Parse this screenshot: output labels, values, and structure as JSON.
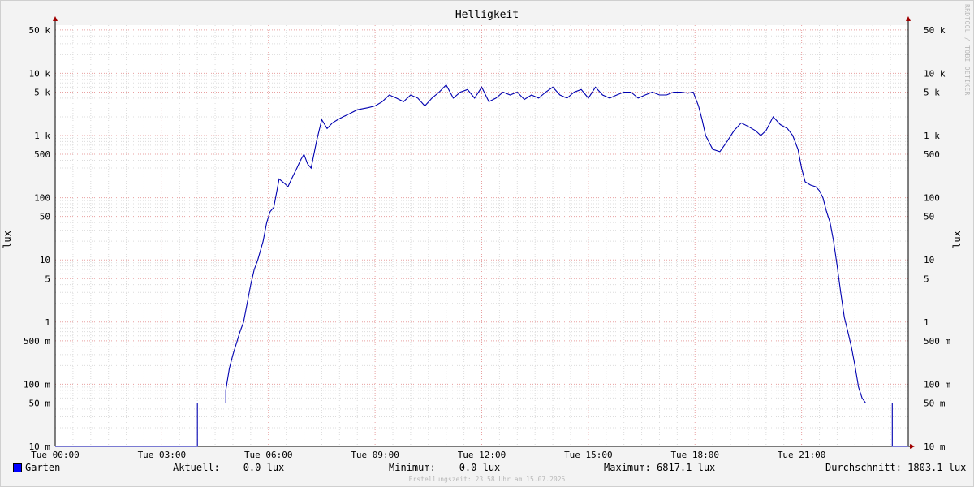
{
  "title": "Helligkeit",
  "watermark": "RRDTOOL / TOBI OETIKER",
  "legend": {
    "series_name": "Garten",
    "current": "Aktuell:    0.0 lux",
    "minimum": "Minimum:    0.0 lux",
    "maximum": "Maximum: 6817.1 lux",
    "average": "Durchschnitt: 1803.1 lux"
  },
  "footer": "Erstellungszeit: 23:58 Uhr am 15.07.2025",
  "colors": {
    "series": "#0000b0",
    "grid_major": "#e8a0a0",
    "grid_minor": "#dcdcdc",
    "background": "#ffffff",
    "axis_arrow": "#a00000",
    "legend_swatch": "#0000ff"
  },
  "chart_data": {
    "type": "line",
    "title": "Helligkeit",
    "ylabel": "lux",
    "yscale": "log",
    "ylim": [
      0.01,
      100000
    ],
    "xlim_hours": [
      0,
      24
    ],
    "grid": true,
    "x_ticks": [
      {
        "hour": 0,
        "label": "Tue 00:00"
      },
      {
        "hour": 3,
        "label": "Tue 03:00"
      },
      {
        "hour": 6,
        "label": "Tue 06:00"
      },
      {
        "hour": 9,
        "label": "Tue 09:00"
      },
      {
        "hour": 12,
        "label": "Tue 12:00"
      },
      {
        "hour": 15,
        "label": "Tue 15:00"
      },
      {
        "hour": 18,
        "label": "Tue 18:00"
      },
      {
        "hour": 21,
        "label": "Tue 21:00"
      }
    ],
    "y_ticks": [
      {
        "value": 0.01,
        "label": "10 m"
      },
      {
        "value": 0.05,
        "label": "50 m"
      },
      {
        "value": 0.1,
        "label": "100 m"
      },
      {
        "value": 0.5,
        "label": "500 m"
      },
      {
        "value": 1,
        "label": "1"
      },
      {
        "value": 5,
        "label": "5"
      },
      {
        "value": 10,
        "label": "10"
      },
      {
        "value": 50,
        "label": "50"
      },
      {
        "value": 100,
        "label": "100"
      },
      {
        "value": 500,
        "label": "500"
      },
      {
        "value": 1000,
        "label": "1 k"
      },
      {
        "value": 5000,
        "label": "5 k"
      },
      {
        "value": 10000,
        "label": "10 k"
      },
      {
        "value": 50000,
        "label": "50 k"
      }
    ],
    "series": [
      {
        "name": "Garten",
        "x_hours": [
          0,
          4.0,
          4.0,
          4.8,
          4.8,
          4.9,
          5.0,
          5.2,
          5.3,
          5.4,
          5.5,
          5.6,
          5.7,
          5.85,
          5.95,
          6.05,
          6.15,
          6.3,
          6.45,
          6.55,
          6.65,
          6.8,
          6.9,
          7.0,
          7.1,
          7.2,
          7.35,
          7.5,
          7.65,
          7.8,
          7.95,
          8.1,
          8.25,
          8.5,
          8.8,
          9.0,
          9.2,
          9.4,
          9.6,
          9.8,
          10.0,
          10.2,
          10.4,
          10.6,
          10.8,
          11.0,
          11.2,
          11.4,
          11.6,
          11.8,
          12.0,
          12.2,
          12.4,
          12.6,
          12.8,
          13.0,
          13.2,
          13.4,
          13.6,
          13.8,
          14.0,
          14.2,
          14.4,
          14.6,
          14.8,
          15.0,
          15.2,
          15.4,
          15.6,
          15.8,
          16.0,
          16.2,
          16.4,
          16.6,
          16.8,
          17.0,
          17.2,
          17.4,
          17.6,
          17.8,
          17.95,
          18.1,
          18.2,
          18.3,
          18.5,
          18.7,
          18.9,
          19.1,
          19.3,
          19.5,
          19.7,
          19.85,
          20.0,
          20.2,
          20.4,
          20.6,
          20.75,
          20.9,
          21.0,
          21.1,
          21.25,
          21.4,
          21.5,
          21.6,
          21.7,
          21.8,
          21.9,
          22.0,
          22.1,
          22.2,
          22.3,
          22.4,
          22.5,
          22.6,
          22.7,
          22.8,
          22.9,
          23.0,
          23.0,
          23.55,
          23.55,
          24.0
        ],
        "values": [
          0.01,
          0.01,
          0.05,
          0.05,
          0.08,
          0.18,
          0.3,
          0.7,
          1.0,
          2.0,
          4.0,
          7.0,
          10.0,
          20.0,
          40.0,
          60.0,
          70.0,
          200.0,
          170.0,
          150.0,
          200.0,
          300.0,
          400.0,
          500.0,
          350.0,
          300.0,
          800.0,
          1800.0,
          1300.0,
          1600.0,
          1800.0,
          2000.0,
          2200.0,
          2600.0,
          2800.0,
          3000.0,
          3500.0,
          4500.0,
          4000.0,
          3500.0,
          4500.0,
          4000.0,
          3000.0,
          4000.0,
          5000.0,
          6500.0,
          4000.0,
          5000.0,
          5500.0,
          4000.0,
          6000.0,
          3500.0,
          4000.0,
          5000.0,
          4500.0,
          5000.0,
          3800.0,
          4500.0,
          4000.0,
          5000.0,
          6000.0,
          4500.0,
          4000.0,
          5000.0,
          5500.0,
          4000.0,
          6000.0,
          4500.0,
          4000.0,
          4500.0,
          5000.0,
          5000.0,
          4000.0,
          4500.0,
          5000.0,
          4500.0,
          4500.0,
          5000.0,
          5000.0,
          4800.0,
          5000.0,
          3000.0,
          1800.0,
          1000.0,
          600.0,
          550.0,
          800.0,
          1200.0,
          1600.0,
          1400.0,
          1200.0,
          1000.0,
          1200.0,
          2000.0,
          1500.0,
          1300.0,
          1000.0,
          600.0,
          300.0,
          180.0,
          160.0,
          150.0,
          130.0,
          100.0,
          60.0,
          40.0,
          20.0,
          8.0,
          3.0,
          1.2,
          0.7,
          0.4,
          0.2,
          0.09,
          0.06,
          0.05,
          0.05,
          0.05,
          0.05,
          0.05,
          0.01,
          0.01,
          0.01
        ]
      }
    ]
  }
}
